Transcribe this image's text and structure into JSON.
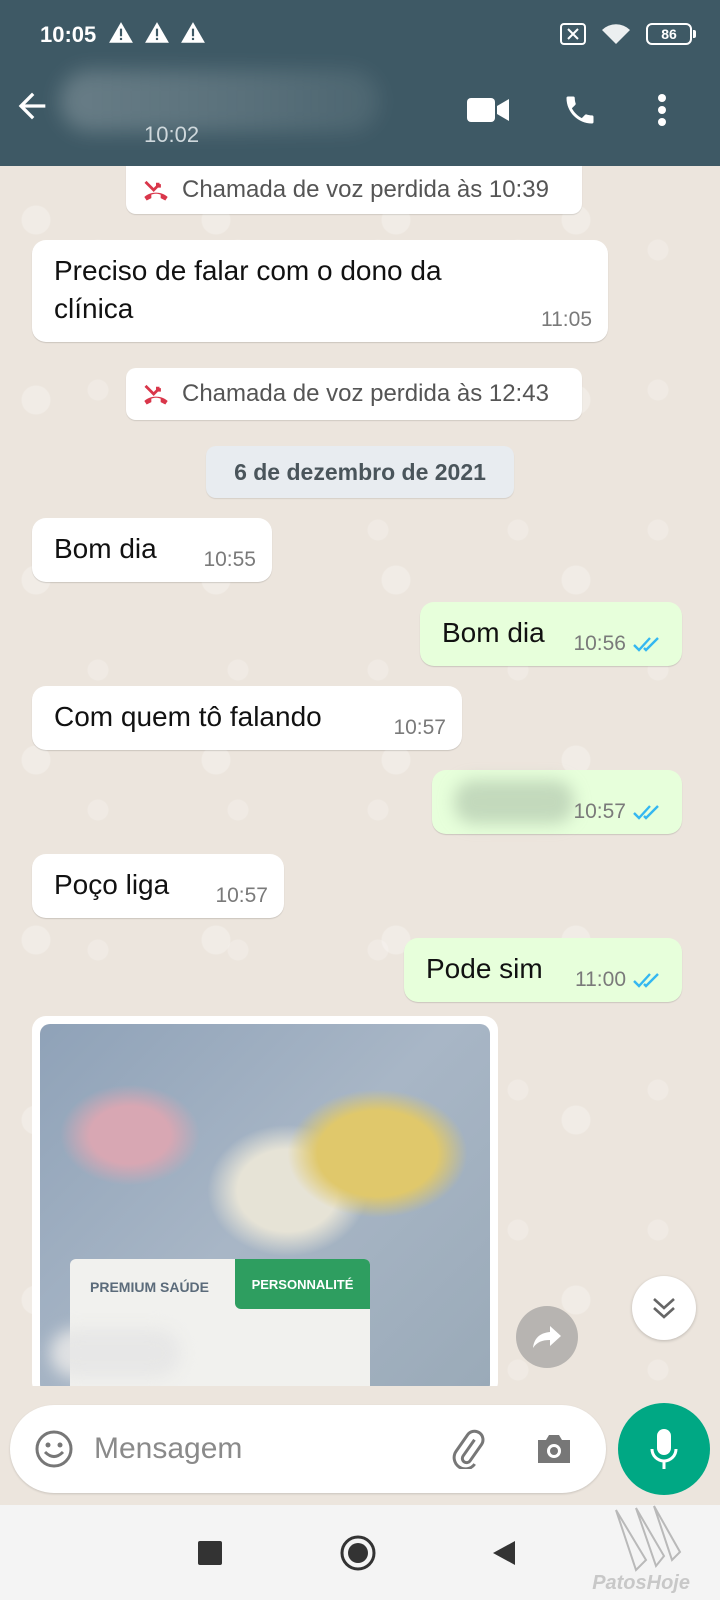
{
  "status_bar": {
    "time": "10:05",
    "battery": "86"
  },
  "header": {
    "contact_subtitle": "10:02"
  },
  "messages": {
    "missed1": "Chamada de voz perdida às 10:39",
    "m1_line1": "Preciso de falar  com o dono da",
    "m1_line2": "clínica",
    "m1_time": "11:05",
    "missed2": "Chamada de voz perdida às 12:43",
    "date": "6 de dezembro de 2021",
    "m2_text": "Bom dia",
    "m2_time": "10:55",
    "m3_text": "Bom dia",
    "m3_time": "10:56",
    "m4_text": "Com quem tô falando",
    "m4_time": "10:57",
    "m5_time": "10:57",
    "m6_text": "Poço liga",
    "m6_time": "10:57",
    "m7_text": "Pode sim",
    "m7_time": "11:00"
  },
  "photo": {
    "card_brand": "PREMIUM SAÚDE",
    "card_badge": "PERSONNALITÉ"
  },
  "composer": {
    "placeholder": "Mensagem"
  },
  "watermark": "PatosHoje",
  "colors": {
    "header": "#3e5965",
    "outgoing": "#e7ffdb",
    "accent": "#00a884",
    "read_ticks": "#34b7f1",
    "missed_call": "#d9364a"
  },
  "icons": [
    "back-arrow-icon",
    "video-call-icon",
    "phone-icon",
    "more-options-icon",
    "missed-call-icon",
    "double-check-icon",
    "forward-icon",
    "chevron-double-down-icon",
    "emoji-icon",
    "attach-icon",
    "camera-icon",
    "microphone-icon",
    "recent-apps-icon",
    "home-icon",
    "back-icon"
  ]
}
